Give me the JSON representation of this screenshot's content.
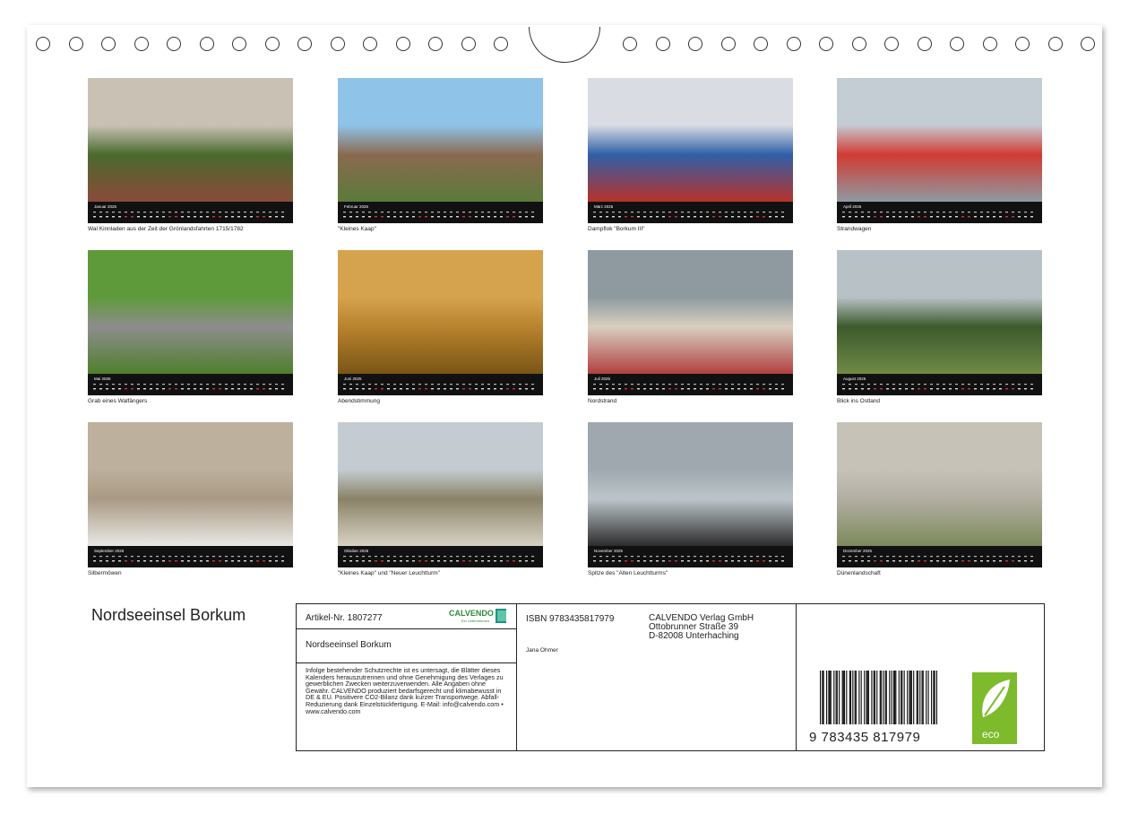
{
  "months": [
    {
      "name": "Januar 2025",
      "caption": "Wal Kinnladen aus der Zeit der Grönlandsfahrten 1715/1782",
      "colors": [
        "#c9c2b4",
        "#4a6a2e",
        "#8a4b3a"
      ]
    },
    {
      "name": "Februar 2025",
      "caption": "\"Kleines Kaap\"",
      "colors": [
        "#8fc3e8",
        "#8a6a50",
        "#5b7a3a"
      ]
    },
    {
      "name": "März 2025",
      "caption": "Dampflok \"Borkum III\"",
      "colors": [
        "#d9dde3",
        "#2f5fa8",
        "#b8322a"
      ]
    },
    {
      "name": "April 2025",
      "caption": "Strandwagen",
      "colors": [
        "#c4ccd4",
        "#d23a32",
        "#8e9aa2"
      ]
    },
    {
      "name": "Mai 2025",
      "caption": "Grab eines Walfängers",
      "colors": [
        "#5f9a3a",
        "#8d8d8d",
        "#4f7f2c"
      ]
    },
    {
      "name": "Juni 2025",
      "caption": "Abendstimmung",
      "colors": [
        "#d5a24e",
        "#b8832e",
        "#7a5516"
      ]
    },
    {
      "name": "Juli 2025",
      "caption": "Nordstrand",
      "colors": [
        "#8e9aa0",
        "#d8cfbf",
        "#b04040"
      ]
    },
    {
      "name": "August 2025",
      "caption": "Blick ins Ostland",
      "colors": [
        "#b8c2c6",
        "#3c5a2c",
        "#6f8a45"
      ]
    },
    {
      "name": "September 2025",
      "caption": "Silbermöwen",
      "colors": [
        "#bdb09c",
        "#a89a84",
        "#e8e8e4"
      ]
    },
    {
      "name": "Oktober 2025",
      "caption": "\"Kleines Kaap\" und \"Neuer Leuchtturm\"",
      "colors": [
        "#c4ccd2",
        "#8a8266",
        "#d8d2c4"
      ]
    },
    {
      "name": "November 2025",
      "caption": "Spitze des \"Alten Leuchtturms\"",
      "colors": [
        "#9ea8ae",
        "#bcc5ca",
        "#2c2c2c"
      ]
    },
    {
      "name": "Dezember 2025",
      "caption": "Dünenlandschaft",
      "colors": [
        "#c6c2b8",
        "#b2aea2",
        "#7c8a5c"
      ]
    }
  ],
  "title": "Nordseeinsel Borkum",
  "info": {
    "artikel": "Artikel-Nr. 1807277",
    "brand": "CALVENDO",
    "brand_tag": "Ein Unternehmen",
    "box_title": "Nordseeinsel Borkum",
    "legal": "Infolge bestehender Schutzrechte ist es untersagt, die Blätter dieses Kalenders herauszutrennen und ohne Genehmigung des Verlages zu gewerblichen Zwecken weiterzuverwenden. Alle Angaben ohne Gewähr. CALVENDO produziert bedarfsgerecht und klimabewusst in DE & EU. Positivere CO2-Bilanz dank kurzer Transportwege. Abfall-Reduzierung dank Einzelstückfertigung. E-Mail: info@calvendo.com • www.calvendo.com",
    "isbn": "ISBN 9783435817979",
    "publisher": [
      "CALVENDO Verlag GmbH",
      "Ottobrunner Straße 39",
      "D-82008 Unterhaching"
    ],
    "author": "Jana Ohmer",
    "barcode_text": "9 783435 817979",
    "eco_label": "eco"
  }
}
